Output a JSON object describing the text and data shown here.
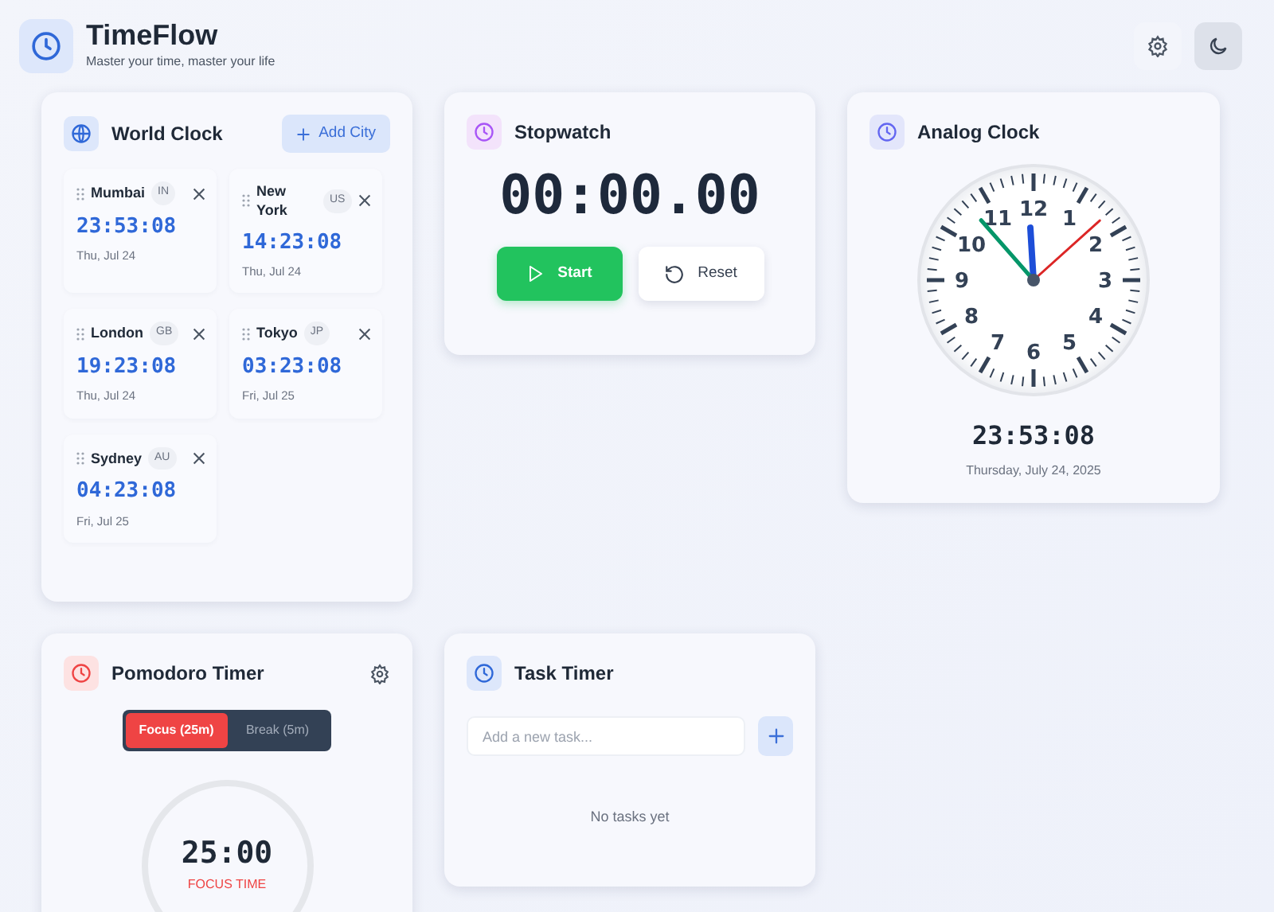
{
  "header": {
    "title": "TimeFlow",
    "tagline": "Master your time, master your life"
  },
  "world_clock": {
    "title": "World Clock",
    "add_button": "Add City",
    "cities": [
      {
        "name": "Mumbai",
        "code": "IN",
        "time": "23:53:08",
        "date": "Thu, Jul 24"
      },
      {
        "name": "New York",
        "code": "US",
        "time": "14:23:08",
        "date": "Thu, Jul 24"
      },
      {
        "name": "London",
        "code": "GB",
        "time": "19:23:08",
        "date": "Thu, Jul 24"
      },
      {
        "name": "Tokyo",
        "code": "JP",
        "time": "03:23:08",
        "date": "Fri, Jul 25"
      },
      {
        "name": "Sydney",
        "code": "AU",
        "time": "04:23:08",
        "date": "Fri, Jul 25"
      }
    ]
  },
  "stopwatch": {
    "title": "Stopwatch",
    "display": "00:00.00",
    "buttons": [
      {
        "label": "Start",
        "kind": "primary"
      },
      {
        "label": "Reset",
        "kind": "secondary"
      }
    ]
  },
  "analog_clock": {
    "title": "Analog Clock",
    "dial_numbers": [
      "12",
      "11",
      "1",
      "10",
      "2",
      "9",
      "3",
      "8",
      "4",
      "7",
      "5",
      "6"
    ],
    "time": "23:53:08",
    "date": "Thursday, July 24, 2025"
  },
  "pomodoro": {
    "title": "Pomodoro Timer",
    "modes": [
      {
        "label": "Focus (25m)",
        "selected": true
      },
      {
        "label": "Break (5m)",
        "selected": false
      }
    ],
    "time": "25:00",
    "caption": "FOCUS TIME"
  },
  "task_timer": {
    "title": "Task Timer",
    "placeholder": "Add a new task...",
    "empty_text": "No tasks yet"
  }
}
